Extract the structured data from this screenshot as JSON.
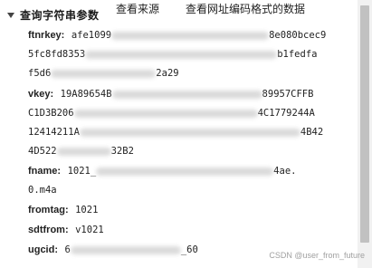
{
  "toolbar": {
    "title": "查询字符串参数",
    "view_source": "查看来源",
    "view_url_encoded": "查看网址编码格式的数据"
  },
  "params": {
    "ftnrkey": {
      "key": "ftnrkey:",
      "line1_start": "afe1099",
      "line1_end": "8e080bcec9",
      "line2_start": "5fc8fd8353",
      "line2_end": "b1fedfa",
      "line3_start": "f5d6",
      "line3_end": "2a29"
    },
    "vkey": {
      "key": "vkey:",
      "line1_start": "19A89654B",
      "line1_end": "89957CFFB",
      "line2_start": "C1D3B206",
      "line2_end": "4C1779244A",
      "line3_start": "12414211A",
      "line3_end": "4B42",
      "line4_start": "4D522",
      "line4_end": "32B2"
    },
    "fname": {
      "key": "fname:",
      "line1_start": "1021_",
      "line1_end": "4ae.",
      "line2": "0.m4a"
    },
    "fromtag": {
      "key": "fromtag:",
      "value": "1021"
    },
    "sdtfrom": {
      "key": "sdtfrom:",
      "value": "v1021"
    },
    "ugcid": {
      "key": "ugcid:",
      "value_start": "6",
      "value_end": "_60"
    }
  },
  "watermark": "CSDN @user_from_future"
}
